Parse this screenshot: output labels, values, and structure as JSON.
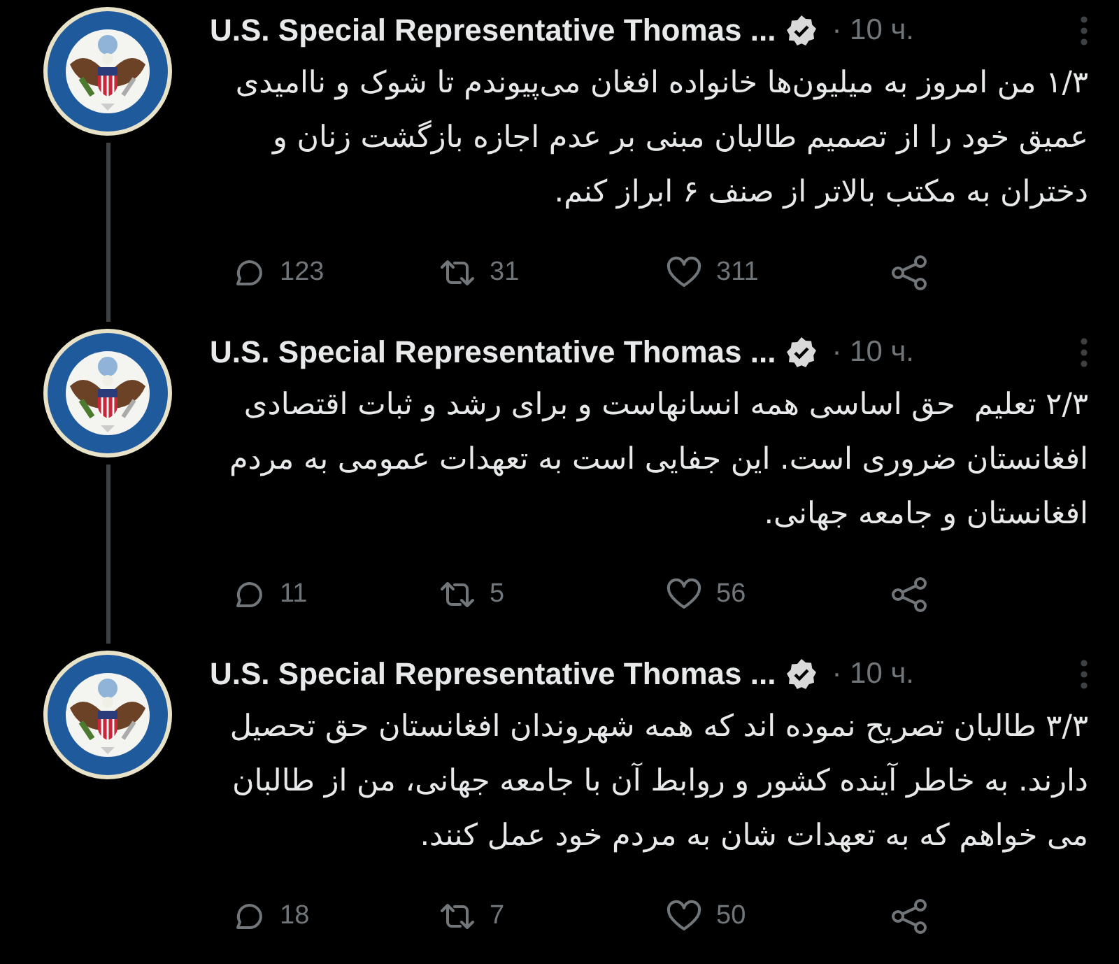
{
  "tweets": [
    {
      "author": "U.S. Special Representative Thomas ...",
      "verified": true,
      "time": "· 10 ч.",
      "text": "۱/۳ من امروز به میلیون‌ها خانواده افغان می‌پیوندم تا شوک و ناامیدی عمیق خود را از تصمیم طالبان مبنی بر عدم اجازه بازگشت زنان و دختران به مکتب بالاتر از صنف ۶ ابراز کنم.",
      "replies": "123",
      "retweets": "31",
      "likes": "311",
      "thread_continues": true
    },
    {
      "author": "U.S. Special Representative Thomas ...",
      "verified": true,
      "time": "· 10 ч.",
      "text": "۲/۳ تعلیم  حق اساسی همه انسانهاست و برای رشد و ثبات اقتصادی افغانستان ضروری است. این جفایی است به تعهدات عمومی به مردم افغانستان و جامعه جهانی.",
      "replies": "11",
      "retweets": "5",
      "likes": "56",
      "thread_continues": true
    },
    {
      "author": "U.S. Special Representative Thomas ...",
      "verified": true,
      "time": "· 10 ч.",
      "text": "۳/۳ طالبان تصریح نموده اند که همه شهروندان افغانستان حق تحصیل دارند. به خاطر آینده کشور و روابط آن با جامعه جهانی، من از طالبان می خواهم که به تعهدات شان به مردم خود عمل کنند.",
      "replies": "18",
      "retweets": "7",
      "likes": "50",
      "thread_continues": false
    }
  ]
}
